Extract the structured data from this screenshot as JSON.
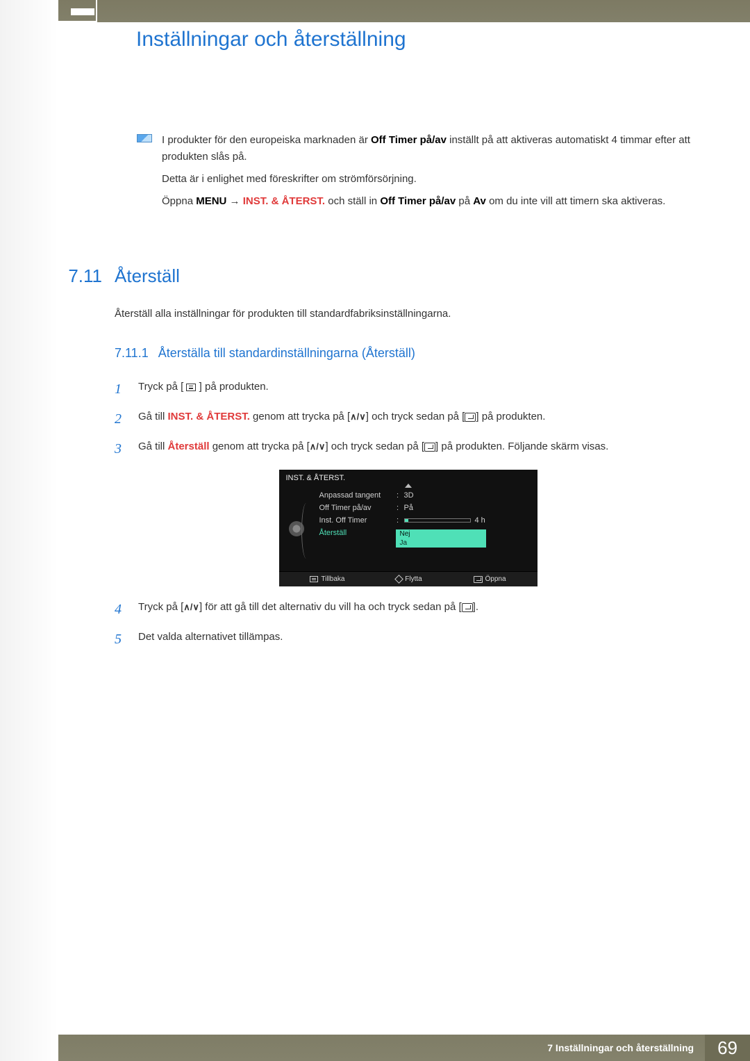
{
  "header": {
    "title": "Inställningar och återställning"
  },
  "note": {
    "p1_pre": "I produkter för den europeiska marknaden är ",
    "p1_bold": "Off Timer på/av",
    "p1_post": " inställt på att aktiveras automatiskt 4 timmar efter att produkten slås på.",
    "p2": "Detta är i enlighet med föreskrifter om strömförsörjning.",
    "p3_pre": "Öppna ",
    "p3_menu": "MENU",
    "p3_arrow": " → ",
    "p3_red": "INST. & ÅTERST.",
    "p3_mid": " och ställ in ",
    "p3_bold2": "Off Timer på/av",
    "p3_mid2": " på ",
    "p3_bold3": "Av",
    "p3_post": " om du inte vill att timern ska aktiveras."
  },
  "section": {
    "num": "7.11",
    "title": "Återställ",
    "intro": "Återställ alla inställningar för produkten till standardfabriksinställningarna."
  },
  "sub": {
    "num": "7.11.1",
    "title": "Återställa till standardinställningarna (Återställ)"
  },
  "steps": {
    "s1": {
      "n": "1",
      "pre": "Tryck på [ ",
      "post": " ] på produkten."
    },
    "s2": {
      "n": "2",
      "pre": "Gå till ",
      "red": "INST. & ÅTERST.",
      "mid1": " genom att trycka på [",
      "mid2": "] och tryck sedan på [",
      "post": "] på produkten."
    },
    "s3": {
      "n": "3",
      "pre": "Gå till ",
      "red": "Återställ",
      "mid1": " genom att trycka på [",
      "mid2": "] och tryck sedan på [",
      "post": "] på produkten. Följande skärm visas."
    },
    "s4": {
      "n": "4",
      "pre": "Tryck på [",
      "mid": "] för att gå till det alternativ du vill ha och tryck sedan på [",
      "post": "]."
    },
    "s5": {
      "n": "5",
      "text": "Det valda alternativet tillämpas."
    }
  },
  "osd": {
    "title": "INST. & ÅTERST.",
    "rows": {
      "r1": {
        "label": "Anpassad tangent",
        "value": "3D"
      },
      "r2": {
        "label": "Off Timer på/av",
        "value": "På"
      },
      "r3": {
        "label": "Inst. Off Timer",
        "value": "4 h"
      },
      "r4": {
        "label": "Återställ"
      }
    },
    "dropdown": {
      "opt1": "Nej",
      "opt2": "Ja"
    },
    "footer": {
      "back": "Tillbaka",
      "move": "Flytta",
      "open": "Öppna"
    }
  },
  "footer": {
    "chapter": "7 Inställningar och återställning",
    "page": "69"
  },
  "glyphs": {
    "updown": "∧/∨"
  }
}
